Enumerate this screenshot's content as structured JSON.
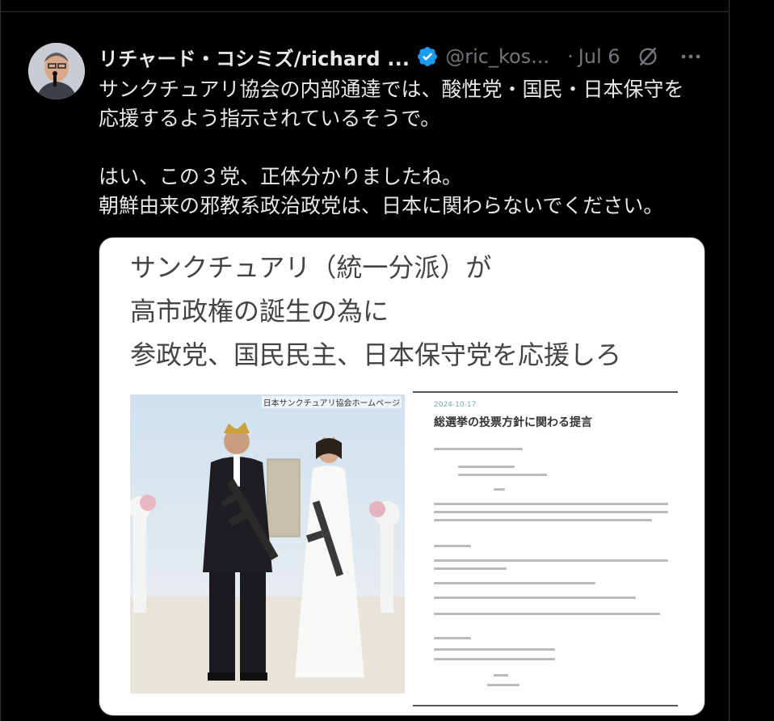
{
  "tweet": {
    "display_name": "リチャード・コシミズ/richard ...",
    "handle": "@ric_kos...",
    "separator": "·",
    "date": "Jul 6",
    "icons": {
      "verified": "verified-badge-icon",
      "grok": "grok-icon",
      "more": "more-options-icon"
    },
    "text_lines": [
      "サンクチュアリ協会の内部通達では、酸性党・国民・日本保守を",
      "応援するよう指示されているそうで。",
      "",
      "はい、この３党、正体分かりましたね。",
      "朝鮮由来の邪教系政治政党は、日本に関わらないでください。"
    ]
  },
  "media": {
    "caption_lines": [
      "サンクチュアリ（統一分派）が",
      "高市政権の誕生の為に",
      "参政党、国民民主、日本保守党を応援しろ"
    ],
    "photo_watermark": "日本サンクチュアリ協会ホームページ",
    "document": {
      "date": "2024-10-17",
      "title": "総選挙の投票方針に関わる提言"
    }
  },
  "colors": {
    "background": "#000000",
    "text": "#e7e9ea",
    "muted": "#71767b",
    "verified": "#1d9bf0",
    "border": "#2f3336"
  }
}
